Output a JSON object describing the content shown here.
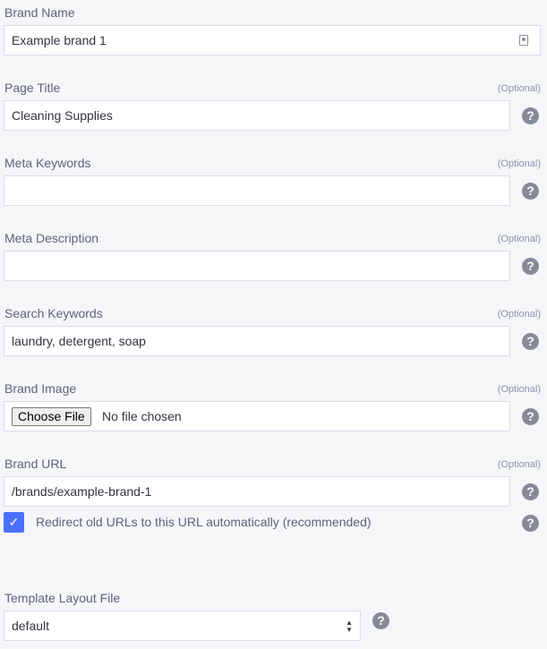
{
  "brand_name": {
    "label": "Brand Name",
    "value": "Example brand 1",
    "icon": "contact-card-icon"
  },
  "page_title": {
    "label": "Page Title",
    "optional": "(Optional)",
    "value": "Cleaning Supplies"
  },
  "meta_keywords": {
    "label": "Meta Keywords",
    "optional": "(Optional)",
    "value": ""
  },
  "meta_description": {
    "label": "Meta Description",
    "optional": "(Optional)",
    "value": ""
  },
  "search_keywords": {
    "label": "Search Keywords",
    "optional": "(Optional)",
    "value": "laundry, detergent, soap"
  },
  "brand_image": {
    "label": "Brand Image",
    "optional": "(Optional)",
    "button": "Choose File",
    "status": "No file chosen"
  },
  "brand_url": {
    "label": "Brand URL",
    "optional": "(Optional)",
    "value": "/brands/example-brand-1"
  },
  "redirect": {
    "label": "Redirect old URLs to this URL automatically (recommended)",
    "checked": true
  },
  "template_layout": {
    "label": "Template Layout File",
    "value": "default"
  },
  "help_glyph": "?",
  "check_glyph": "✓",
  "colors": {
    "accent": "#4b71fc",
    "help_icon": "#858a98",
    "background": "#f5f6f8"
  }
}
